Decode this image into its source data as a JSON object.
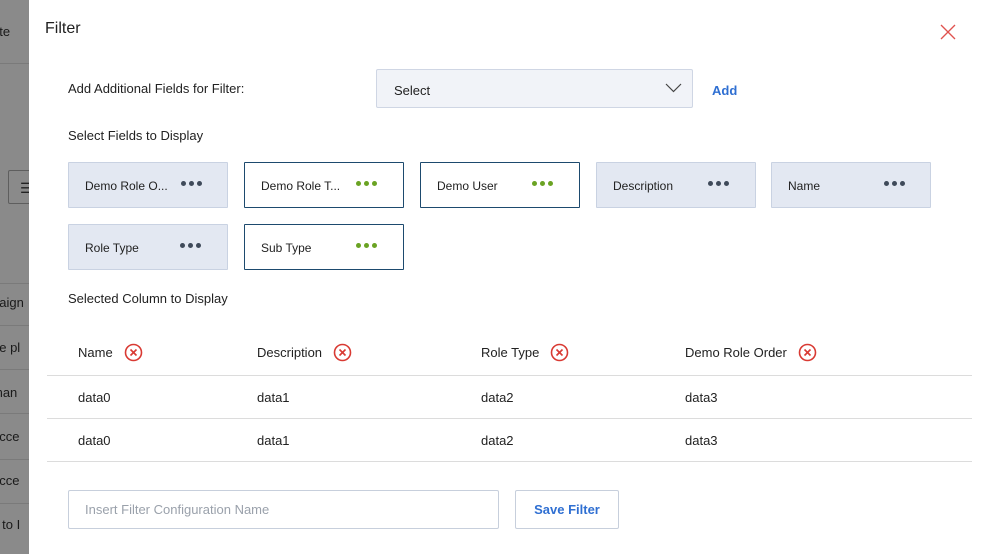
{
  "background": {
    "texts": [
      "ate",
      "paign",
      "ne pl",
      "man",
      "ucce",
      "ucce",
      "s to I"
    ],
    "button_glyph": "☰"
  },
  "modal": {
    "title": "Filter",
    "additional_fields_label": "Add Additional Fields for Filter:",
    "select_value": "Select",
    "add_label": "Add",
    "fields_label": "Select Fields to Display",
    "chips": [
      {
        "label": "Demo Role O...",
        "active": false
      },
      {
        "label": "Demo Role T...",
        "active": true
      },
      {
        "label": "Demo User",
        "active": true
      },
      {
        "label": "Description",
        "active": false
      },
      {
        "label": "Name",
        "active": false
      },
      {
        "label": "Role Type",
        "active": false
      },
      {
        "label": "Sub Type",
        "active": true
      }
    ],
    "selected_columns_label": "Selected Column to Display",
    "columns": [
      "Name",
      "Description",
      "Role Type",
      "Demo Role Order"
    ],
    "rows": [
      [
        "data0",
        "data1",
        "data2",
        "data3"
      ],
      [
        "data0",
        "data1",
        "data2",
        "data3"
      ]
    ],
    "filter_name_placeholder": "Insert Filter Configuration Name",
    "save_label": "Save Filter"
  },
  "colors": {
    "accent": "#2f6fd2",
    "close": "#e0524f",
    "remove": "#d93a33",
    "active_dots": "#6aa323",
    "inactive_chip_bg": "#e3e8f2"
  },
  "icons": [
    "close-icon",
    "chevron-down-icon",
    "more-dots-icon",
    "remove-circle-icon"
  ]
}
